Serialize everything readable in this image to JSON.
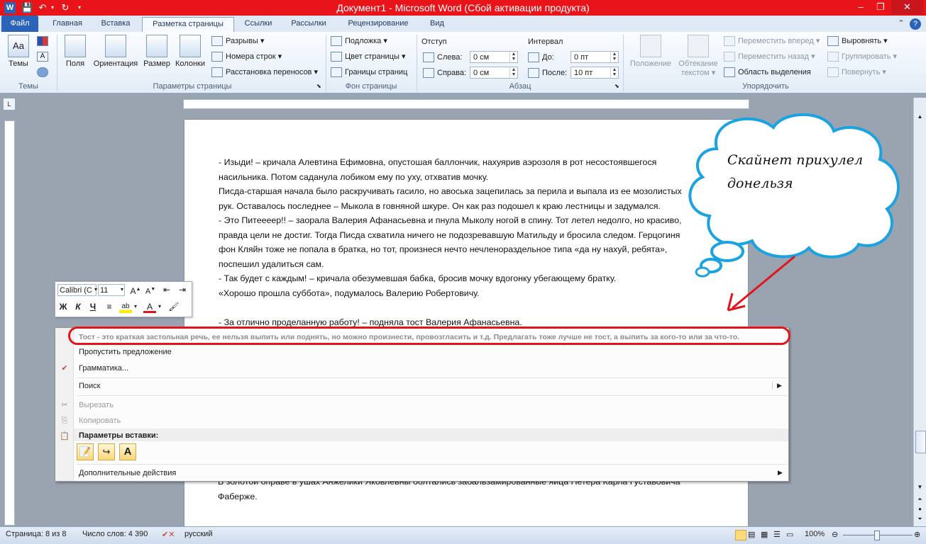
{
  "window": {
    "title": "Документ1 - Microsoft Word (Сбой активации продукта)",
    "controls": [
      "–",
      "❐",
      "✕"
    ]
  },
  "tabs": [
    "Файл",
    "Главная",
    "Вставка",
    "Разметка страницы",
    "Ссылки",
    "Рассылки",
    "Рецензирование",
    "Вид"
  ],
  "ribbon": {
    "themes": {
      "label": "Темы",
      "group": "Темы"
    },
    "page_setup": {
      "group": "Параметры страницы",
      "fields": "Поля",
      "orientation": "Ориентация",
      "size": "Размер",
      "columns": "Колонки",
      "breaks": "Разрывы",
      "line_numbers": "Номера строк",
      "hyphenation": "Расстановка переносов"
    },
    "page_background": {
      "group": "Фон страницы",
      "watermark": "Подложка",
      "page_color": "Цвет страницы",
      "page_borders": "Границы страниц"
    },
    "paragraph": {
      "group": "Абзац",
      "indent": "Отступ",
      "left_label": "Слева:",
      "left_value": "0 см",
      "right_label": "Справа:",
      "right_value": "0 см",
      "spacing": "Интервал",
      "before_label": "До:",
      "before_value": "0 пт",
      "after_label": "После:",
      "after_value": "10 пт"
    },
    "arrange": {
      "group": "Упорядочить",
      "position": "Положение",
      "wrap_line1": "Обтекание",
      "wrap_line2": "текстом",
      "bring_forward": "Переместить вперед",
      "send_backward": "Переместить назад",
      "selection_pane": "Область выделения",
      "align": "Выровнять",
      "group_btn": "Группировать",
      "rotate": "Повернуть"
    }
  },
  "document": {
    "lines": [
      "- Изыди! – кричала Алевтина Ефимовна, опустошая баллончик, нахуярив аэрозоля в рот несостоявшегося",
      "насильника. Потом саданула лобиком ему по уху, отхватив мочку.",
      "Писда-старшая начала было раскручивать гасило, но авоська зацепилась за перила и выпала из ее мозолистых",
      "рук. Оставалось последнее – Мыкола в говняной шкуре. Он как раз подошел к краю лестницы и задумался.",
      "- Это Питеееер!! – заорала Валерия Афанасьевна и пнула Мыколу ногой в спину. Тот летел недолго, но красиво,",
      "правда цели не достиг. Тогда Писда схватила ничего не подозревавшую Матильду и бросила следом. Герцогиня",
      "фон Кляйн тоже не попала в братка, но тот, произнеся нечто нечленораздельное типа «да ну нахуй, ребята»,",
      "поспешил удалиться сам.",
      "- Так будет с каждым! – кричала обезумевшая бабка, бросив мочку вдогонку убегающему братку.",
      "«Хорошо прошла суббота», подумалось Валерию Робертовичу.",
      "",
      "- За отлично проделанную работу! – подняла тост Валерия Афанасьевна."
    ],
    "below_menu": [
      "В золотой оправе в ушах Анжелики Яковлевны болтались забальзамированные яйца Петера Карла Густавовича",
      "Фаберже."
    ]
  },
  "cloud": {
    "line1": "Скайнет прихулел",
    "line2": "донельзя"
  },
  "mini_toolbar": {
    "font": "Calibri (С",
    "size": "11",
    "bold": "Ж",
    "italic": "К",
    "underline": "Ч"
  },
  "context_menu": {
    "suggestion": "Тост - это краткая застольная речь, ее нельзя выпить или поднять, но можно произнести, провозгласить и т.д. Предлагать тоже лучше не тост, а выпить за кого-то или за что-то.",
    "ignore": "Пропустить предложение",
    "grammar": "Грамматика...",
    "search": "Поиск",
    "cut": "Вырезать",
    "copy": "Копировать",
    "paste_options": "Параметры вставки:",
    "more_actions": "Дополнительные действия"
  },
  "status": {
    "page": "Страница: 8 из 8",
    "words": "Число слов: 4 390",
    "language": "русский",
    "zoom": "100%"
  },
  "colors": {
    "titlebar": "#e8141a",
    "accent": "#2a63b8",
    "annotation": "#e3141c",
    "cloud": "#1aa3e0"
  }
}
